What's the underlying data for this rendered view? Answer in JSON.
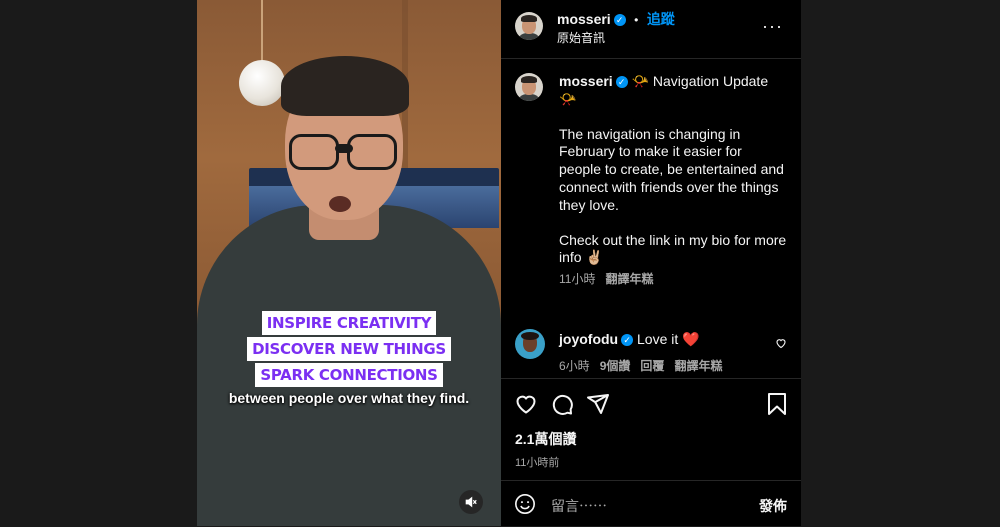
{
  "video": {
    "captions": [
      "INSPIRE CREATIVITY",
      "DISCOVER NEW THINGS",
      "SPARK CONNECTIONS"
    ],
    "subtitle": "between people over what they find.",
    "mute_icon": "muted-speaker-icon"
  },
  "header": {
    "username": "mosseri",
    "separator": "•",
    "follow_label": "追蹤",
    "audio_label": "原始音訊",
    "more_icon": "more-horizontal-icon",
    "more_label": "···"
  },
  "post": {
    "username": "mosseri",
    "title_text": "📯 Navigation Update 📯",
    "paragraph1": "The navigation is changing in February to make it easier for people to create, be entertained and connect with friends over the things they love.",
    "paragraph2": "Check out the link in my bio for more info ✌🏼",
    "time": "11小時",
    "translate_label": "翻譯年糕"
  },
  "comment": {
    "username": "joyofodu",
    "text": "Love it ❤️",
    "time": "6小時",
    "likes": "9個讚",
    "reply_label": "回覆",
    "translate_label": "翻譯年糕"
  },
  "actions": {
    "likes_count": "2.1萬個讚",
    "posted_ago": "11小時前"
  },
  "composer": {
    "placeholder": "留言⋯⋯",
    "post_label": "發佈"
  },
  "colors": {
    "accent": "#0095f6",
    "caption_text": "#7b2ff2",
    "heart_red": "#ff3040"
  }
}
